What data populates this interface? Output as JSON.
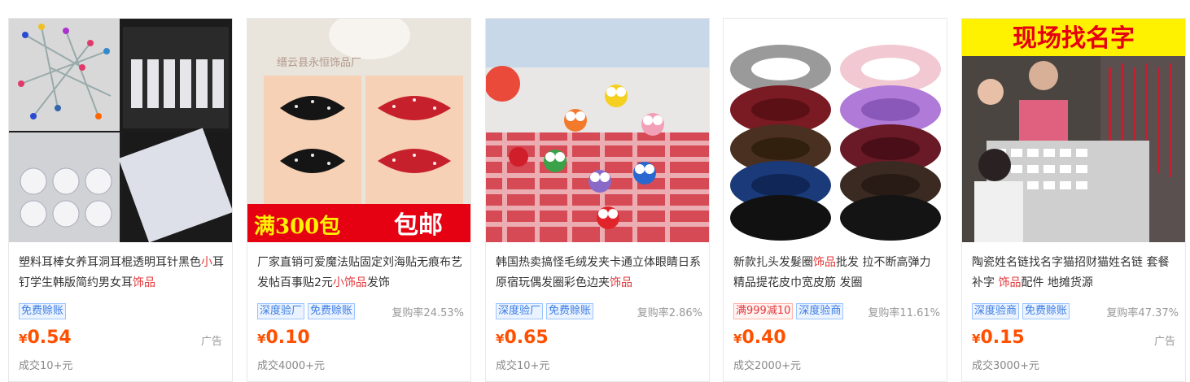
{
  "products": [
    {
      "title_parts": [
        "塑料耳棒女养耳洞耳棍透明耳针黑色",
        "小",
        "耳钉学生韩版简约男女耳",
        "饰品"
      ],
      "tags": [
        "免费赊账"
      ],
      "repurchase": "",
      "currency": "¥",
      "price": "0.54",
      "ad_label": "广告",
      "sold": "成交10+元"
    },
    {
      "title_parts": [
        "厂家直销可爱魔法贴固定刘海贴无痕布艺发帖百事贴2元",
        "小饰品",
        "发饰",
        ""
      ],
      "tags": [
        "深度验厂",
        "免费赊账"
      ],
      "repurchase": "复购率24.53%",
      "currency": "¥",
      "price": "0.10",
      "ad_label": "",
      "sold": "成交4000+元",
      "image_text": [
        "满300包",
        "包邮",
        "缙云县永恒饰品厂"
      ]
    },
    {
      "title_parts": [
        "韩国热卖搞怪毛绒发夹卡通立体眼睛日系原宿玩偶发圈彩色边夹",
        "饰品",
        "",
        ""
      ],
      "tags": [
        "深度验厂",
        "免费赊账"
      ],
      "repurchase": "复购率2.86%",
      "currency": "¥",
      "price": "0.65",
      "ad_label": "",
      "sold": "成交10+元"
    },
    {
      "title_parts": [
        "新款扎头发髮圈",
        "饰品",
        "批发 拉不断高弹力精品提花皮巾宽皮筋 发圈",
        ""
      ],
      "tags_special": "满999减10",
      "tags": [
        "深度验商"
      ],
      "repurchase": "复购率11.61%",
      "currency": "¥",
      "price": "0.40",
      "ad_label": "",
      "sold": "成交2000+元"
    },
    {
      "title_parts": [
        "陶瓷姓名链找名字猫招财猫姓名链 套餐 补字 ",
        "饰品",
        "配件 地摊货源",
        ""
      ],
      "tags": [
        "深度验商",
        "免费赊账"
      ],
      "repurchase": "复购率47.37%",
      "currency": "¥",
      "price": "0.15",
      "ad_label": "广告",
      "sold": "成交3000+元",
      "image_text": [
        "现场找名字"
      ]
    }
  ],
  "colors": {
    "price": "#ff5000",
    "highlight": "#e4393c",
    "tag_blue": "#3d7de4",
    "banner_red": "#e50012",
    "banner_yellow": "#fff200"
  }
}
